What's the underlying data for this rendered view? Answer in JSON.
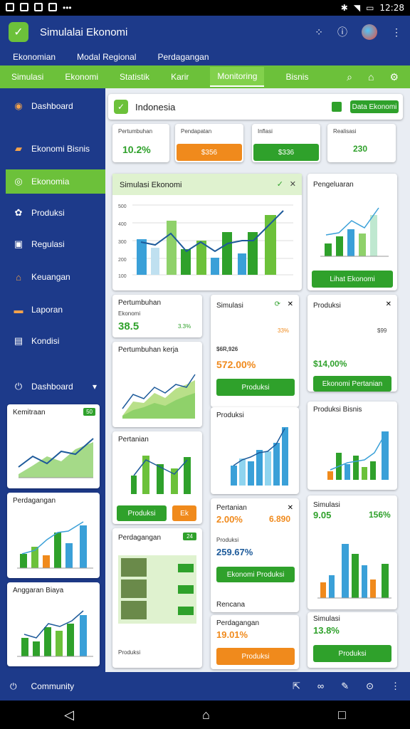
{
  "status": {
    "time": "12:28"
  },
  "app": {
    "title": "Simulalai Ekonomi"
  },
  "subnav": [
    "Ekonomian",
    "Modal Regional",
    "Perdagangan"
  ],
  "greennav": {
    "items": [
      "Simulasi",
      "Ekonomi",
      "Statistik",
      "Karir",
      "Monitoring",
      "Bisnis"
    ],
    "active": "Monitoring"
  },
  "sidebar": {
    "items": [
      "Dashboard",
      "Ekonomi Bisnis",
      "Ekonomia",
      "Produksi",
      "Regulasi",
      "Keuangan",
      "Laporan",
      "Kondisi",
      "Dashboard"
    ],
    "active": "Ekonomia"
  },
  "region": {
    "name": "Indonesia",
    "btn": "Data Ekonomi"
  },
  "kpis": [
    {
      "label": "Pertumbuhan",
      "value": "10.2%"
    },
    {
      "label": "Pendapatan",
      "value": "$356"
    },
    {
      "label": "Inflasi",
      "value": "$336"
    },
    {
      "label": "Realisasi",
      "value": "230"
    }
  ],
  "center_chart": {
    "title": "Simulasi Ekonomi"
  },
  "right_chart": {
    "title": "Pengeluaran",
    "button": "Lihat Ekonomi"
  },
  "mid_left": {
    "title": "Pertumbuhan",
    "sub": "Ekonomi",
    "value": "38.5",
    "pct": "3.3%"
  },
  "mid_left2": {
    "title": "Pertumbuhan kerja"
  },
  "mid_left3": {
    "title": "Pertanian",
    "btn": "Produksi",
    "btn2": "Ek"
  },
  "mid_left4": {
    "title": "Perdagangan",
    "badge": "24",
    "stat": "Produksi"
  },
  "mid_mid": {
    "title": "Simulasi",
    "kpi": "$6R,926",
    "pct": "33%",
    "value": "572.00%",
    "btn": "Produksi"
  },
  "mid_mid2": {
    "title": "Produksi"
  },
  "mid_mid3": {
    "title": "Pertanian",
    "value": "2.00%",
    "pct": "6.890",
    "sub": "Produksi",
    "val2": "259.67%",
    "btn": "Ekonomi Produksi"
  },
  "mid_mid4": {
    "title": "Perdagangan",
    "title2": "Rencana",
    "value": "19.01%",
    "btn": "Produksi"
  },
  "right_mid": {
    "title": "Produksi",
    "value": "$14,00%",
    "kpi": "$99",
    "btn": "Ekonomi Pertanian"
  },
  "right_mid2": {
    "title": "Produksi Bisnis"
  },
  "right_mid3": {
    "title": "Simulasi",
    "value": "9.05",
    "pct": "156%"
  },
  "right_mid4": {
    "title": "Simulasi",
    "value": "13.8%",
    "btn": "Produksi"
  },
  "left_cards": [
    {
      "title": "Kemitraan",
      "badge": "50"
    },
    {
      "title": "Perdagangan"
    },
    {
      "title": "Anggaran Biaya"
    }
  ],
  "bottom": {
    "label": "Community"
  }
}
